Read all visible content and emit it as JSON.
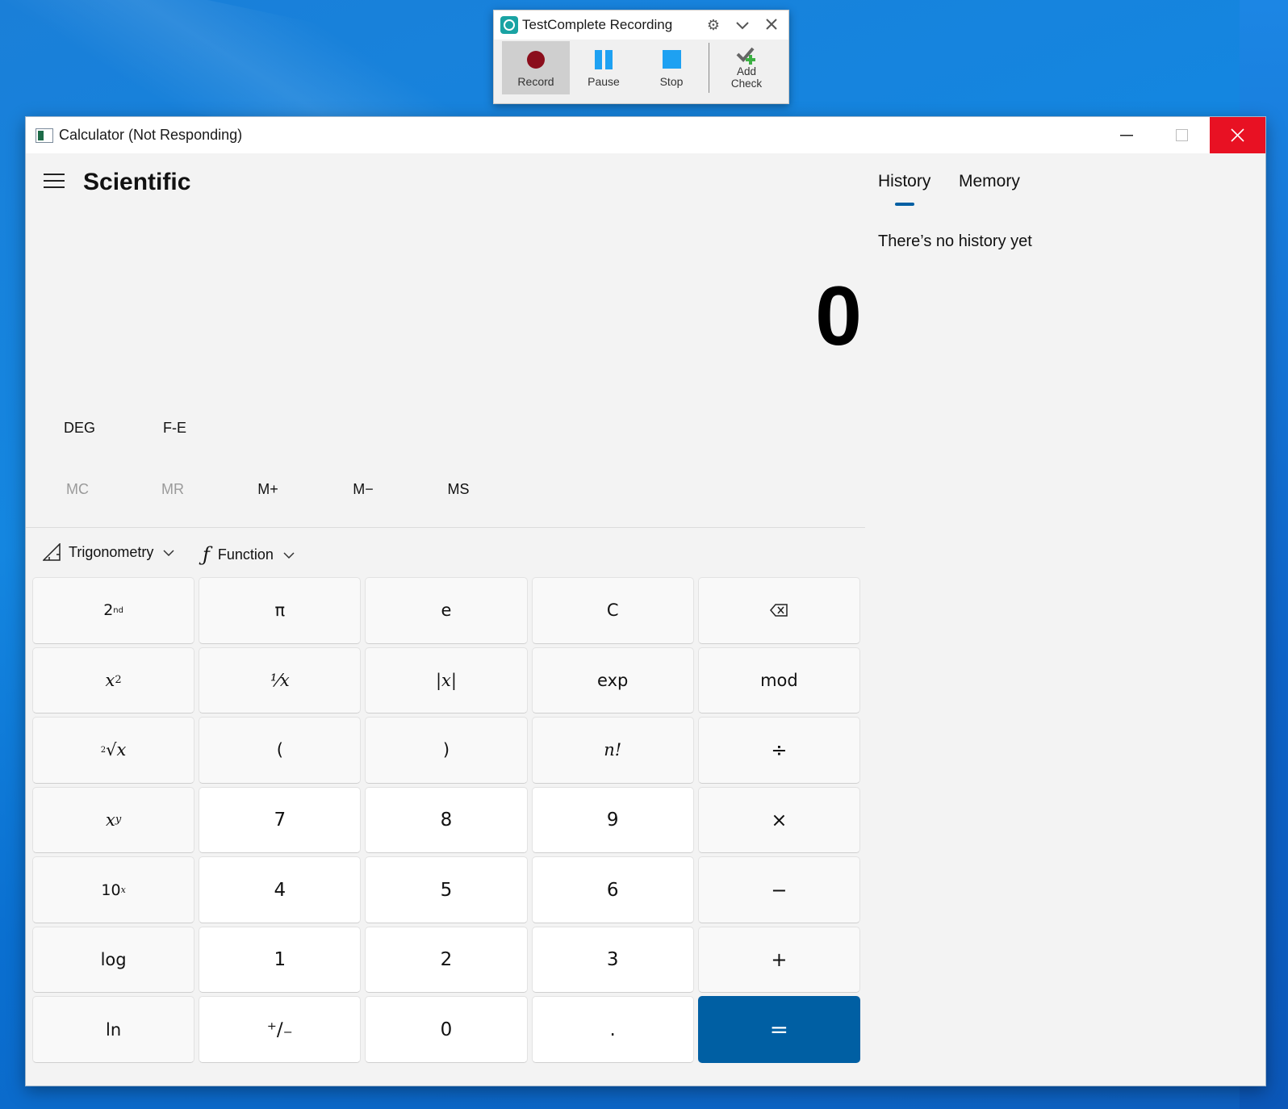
{
  "recorder": {
    "title": "TestComplete Recording",
    "buttons": {
      "record": "Record",
      "pause": "Pause",
      "stop": "Stop",
      "add_check_line1": "Add",
      "add_check_line2": "Check"
    },
    "icons": [
      "testcomplete-logo-icon",
      "gear-icon",
      "chevron-down-icon",
      "close-icon"
    ],
    "colors": {
      "record": "#8b0e1c",
      "pause_stop": "#1ea1f2",
      "check": "#3cb043"
    }
  },
  "window": {
    "title": "Calculator (Not Responding)",
    "controls": {
      "minimize": "—",
      "maximize": "☐",
      "close": "✕"
    }
  },
  "calculator": {
    "mode": "Scientific",
    "display": "0",
    "toggles": {
      "angle": "DEG",
      "fe": "F-E"
    },
    "memory": [
      {
        "label": "MC",
        "enabled": false
      },
      {
        "label": "MR",
        "enabled": false
      },
      {
        "label": "M+",
        "enabled": true
      },
      {
        "label": "M−",
        "enabled": true
      },
      {
        "label": "MS",
        "enabled": true
      }
    ],
    "dropdowns": {
      "trig": "Trigonometry",
      "func": "Function"
    },
    "keys": {
      "second": "2",
      "second_sup": "nd",
      "pi": "π",
      "e": "e",
      "clear": "C",
      "backspace": "⌫",
      "square": "x",
      "square_sup": "2",
      "reciprocal": "⅟x",
      "abs": "|x|",
      "exp": "exp",
      "mod": "mod",
      "root_index": "2",
      "root": "√x",
      "lparen": "(",
      "rparen": ")",
      "factorial": "n!",
      "divide": "÷",
      "power_base": "x",
      "power_sup": "y",
      "seven": "7",
      "eight": "8",
      "nine": "9",
      "multiply": "×",
      "ten_base": "10",
      "ten_sup": "x",
      "four": "4",
      "five": "5",
      "six": "6",
      "minus": "−",
      "log": "log",
      "one": "1",
      "two": "2",
      "three": "3",
      "plus": "+",
      "ln": "ln",
      "negate": "⁺∕₋",
      "zero": "0",
      "decimal": ".",
      "equals": "="
    },
    "accent": "#005fa3"
  },
  "history_pane": {
    "tabs": [
      "History",
      "Memory"
    ],
    "active_tab": "History",
    "empty_message": "There’s no history yet"
  }
}
